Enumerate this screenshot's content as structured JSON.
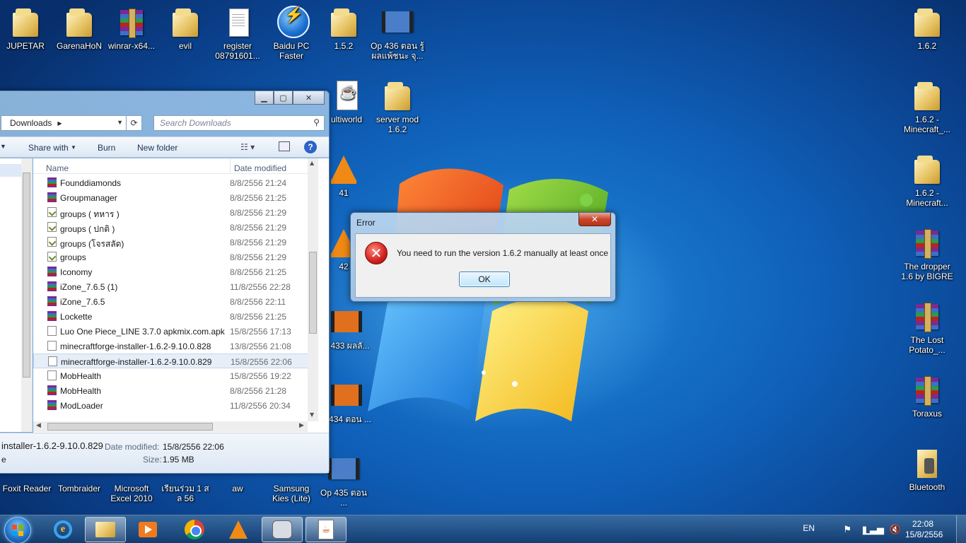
{
  "desktop_icons": [
    {
      "label": "JUPETAR",
      "icon": "person-folder-icon"
    },
    {
      "label": "GarenaHoN",
      "icon": "folder-icon"
    },
    {
      "label": "winrar-x64...",
      "icon": "winrar-icon"
    },
    {
      "label": "evil",
      "icon": "folder-icon"
    },
    {
      "label": "register 08791601...",
      "icon": "document-icon"
    },
    {
      "label": "Baidu PC Faster",
      "icon": "baidu-icon"
    },
    {
      "label": "1.5.2",
      "icon": "folder-icon"
    },
    {
      "label": "Op 436 ตอน รู้ผลแพ้ชนะ จุ...",
      "icon": "video-icon"
    },
    {
      "label": "1.6.2",
      "icon": "folder-icon"
    },
    {
      "label": "ultiworld",
      "icon": "java-icon"
    },
    {
      "label": "server mod 1.6.2",
      "icon": "folder-icon"
    },
    {
      "label": "1.6.2 - Minecraft_...",
      "icon": "folder-icon"
    },
    {
      "label": "41",
      "icon": "vlc-icon"
    },
    {
      "label": "1.6.2 -Minecraft...",
      "icon": "folder-icon"
    },
    {
      "label": "42",
      "icon": "vlc-icon"
    },
    {
      "label": "The dropper 1.6 by BIGRE",
      "icon": "winrar-icon"
    },
    {
      "label": "p 433 ผลลั...",
      "icon": "video-icon"
    },
    {
      "label": "The Lost Potato_...",
      "icon": "winrar-icon"
    },
    {
      "label": "p 434 ตอน ...",
      "icon": "video-icon"
    },
    {
      "label": "Toraxus",
      "icon": "winrar-icon"
    },
    {
      "label": "Foxit Reader",
      "icon": "foxit-icon"
    },
    {
      "label": "Tombraider",
      "icon": "game-icon"
    },
    {
      "label": "Microsoft Excel 2010",
      "icon": "excel-icon"
    },
    {
      "label": "เรียนร่วม 1 ส ล 56",
      "icon": "folder-icon"
    },
    {
      "label": "aw",
      "icon": "folder-icon"
    },
    {
      "label": "Samsung Kies (Lite)",
      "icon": "kies-icon"
    },
    {
      "label": "Op 435 ตอน ...",
      "icon": "video-icon"
    },
    {
      "label": "Bluetooth",
      "icon": "bluetooth-folder-icon"
    }
  ],
  "explorer": {
    "breadcrumb": "Downloads",
    "search_placeholder": "Search Downloads",
    "toolbar": {
      "share": "Share with",
      "burn": "Burn",
      "new_folder": "New folder"
    },
    "columns": {
      "name": "Name",
      "date": "Date modified"
    },
    "files": [
      {
        "name": "Founddiamonds",
        "date": "8/8/2556 21:24",
        "icon": "winrar-icon"
      },
      {
        "name": "Groupmanager",
        "date": "8/8/2556 21:25",
        "icon": "winrar-icon"
      },
      {
        "name": "groups ( ทหาร )",
        "date": "8/8/2556 21:29",
        "icon": "text-file-icon"
      },
      {
        "name": "groups ( ปกติ )",
        "date": "8/8/2556 21:29",
        "icon": "text-file-icon"
      },
      {
        "name": "groups (โจรสลัด)",
        "date": "8/8/2556 21:29",
        "icon": "text-file-icon"
      },
      {
        "name": "groups",
        "date": "8/8/2556 21:29",
        "icon": "text-file-icon"
      },
      {
        "name": "Iconomy",
        "date": "8/8/2556 21:25",
        "icon": "winrar-icon"
      },
      {
        "name": "iZone_7.6.5 (1)",
        "date": "11/8/2556 22:28",
        "icon": "winrar-icon"
      },
      {
        "name": "iZone_7.6.5",
        "date": "8/8/2556 22:11",
        "icon": "winrar-icon"
      },
      {
        "name": "Lockette",
        "date": "8/8/2556 21:25",
        "icon": "winrar-icon"
      },
      {
        "name": "Luo One Piece_LINE 3.7.0 apkmix.com.apk",
        "date": "15/8/2556 17:13",
        "icon": "file-icon"
      },
      {
        "name": "minecraftforge-installer-1.6.2-9.10.0.828",
        "date": "13/8/2556 21:08",
        "icon": "file-icon"
      },
      {
        "name": "minecraftforge-installer-1.6.2-9.10.0.829",
        "date": "15/8/2556 22:06",
        "icon": "file-icon",
        "selected": true
      },
      {
        "name": "MobHealth",
        "date": "15/8/2556 19:22",
        "icon": "file-icon"
      },
      {
        "name": "MobHealth",
        "date": "8/8/2556 21:28",
        "icon": "winrar-icon"
      },
      {
        "name": "ModLoader",
        "date": "11/8/2556 20:34",
        "icon": "winrar-icon"
      }
    ],
    "details": {
      "name": "installer-1.6.2-9.10.0.829",
      "modified_label": "Date modified:",
      "modified_value": "15/8/2556 22:06",
      "size_label": "Size:",
      "size_value": "1.95 MB",
      "type_fragment": "e"
    }
  },
  "error_dialog": {
    "title": "Error",
    "message": "You need to run the version 1.6.2 manually at least once",
    "ok_label": "OK"
  },
  "taskbar": {
    "language": "EN",
    "time": "22:08",
    "date": "15/8/2556",
    "pinned": [
      "internet-explorer-icon",
      "explorer-folder-icon",
      "media-player-icon",
      "chrome-icon",
      "vlc-icon",
      "samsung-kies-icon",
      "java-icon"
    ]
  }
}
